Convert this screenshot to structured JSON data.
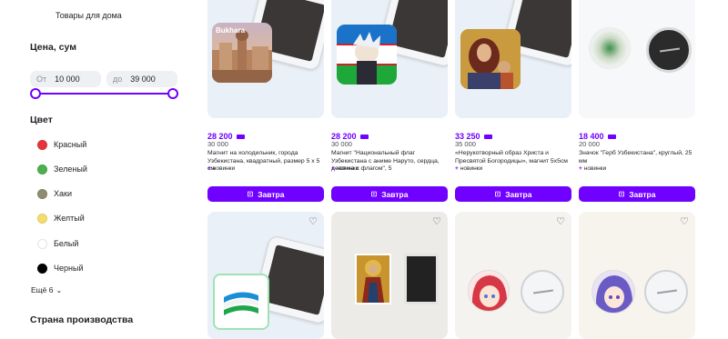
{
  "sidebar": {
    "category_item": "Товары для дома",
    "price": {
      "title": "Цена, сум",
      "from_prefix": "От",
      "from_value": "10 000",
      "to_prefix": "до",
      "to_value": "39 000"
    },
    "color": {
      "title": "Цвет",
      "options": [
        {
          "label": "Красный",
          "color": "#e8333b"
        },
        {
          "label": "Зеленый",
          "color": "#4caf50"
        },
        {
          "label": "Хаки",
          "color": "#8f8c6f"
        },
        {
          "label": "Желтый",
          "color": "#f5dd6b"
        },
        {
          "label": "Белый",
          "color": "#ffffff"
        },
        {
          "label": "Черный",
          "color": "#000000"
        }
      ],
      "more_label": "Ещё 6"
    },
    "country_title": "Страна производства"
  },
  "products": [
    {
      "price": "28 200",
      "old_price": "30 000",
      "title": "Магнит на холодильник, города Узбекистана, квадратный, размер 5 х 5 см",
      "badge": "новинки",
      "button": "Завтра",
      "image_caption": "Bukhara"
    },
    {
      "price": "28 200",
      "old_price": "30 000",
      "title": "Магнит \"Национальный флаг Узбекистана с аниме Наруто, сердца, девочка с флагом\", 5",
      "badge": "новинки",
      "button": "Завтра"
    },
    {
      "price": "33 250",
      "old_price": "35 000",
      "title": "«Нерукотворный образ Христа и Пресвятой Богородицы», магнит 5х5см",
      "badge": "новинки",
      "button": "Завтра"
    },
    {
      "price": "18 400",
      "old_price": "20 000",
      "title": "Значок \"Герб Узбекистана\", круглый, 25 мм",
      "badge": "новинки",
      "button": "Завтра"
    }
  ],
  "accent_color": "#7000ff"
}
